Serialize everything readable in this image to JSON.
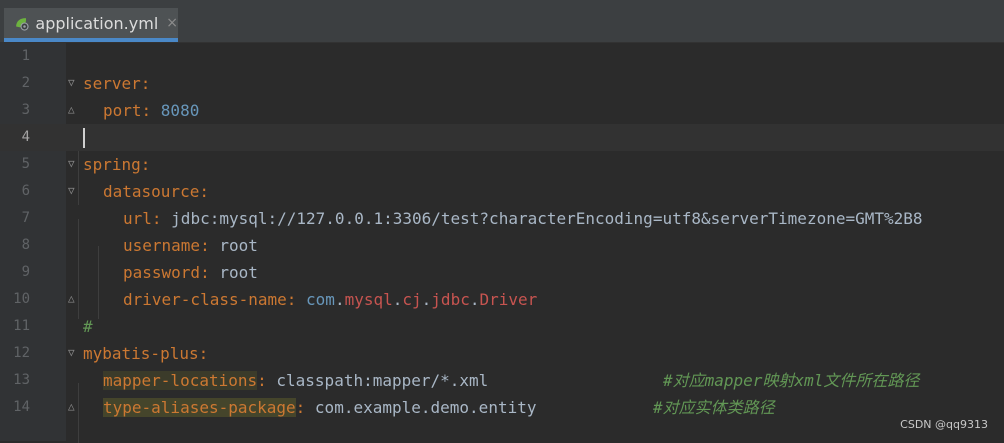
{
  "tab": {
    "title": "application.yml",
    "close": "×"
  },
  "lines": [
    {
      "num": "1"
    },
    {
      "num": "2",
      "key": "server",
      "colon": ":"
    },
    {
      "num": "3",
      "key": "port",
      "colon": ": ",
      "value": "8080"
    },
    {
      "num": "4"
    },
    {
      "num": "5",
      "key": "spring",
      "colon": ":"
    },
    {
      "num": "6",
      "key": "datasource",
      "colon": ":"
    },
    {
      "num": "7",
      "key": "url",
      "colon": ": ",
      "value": "jdbc:mysql://127.0.0.1:3306/test?characterEncoding=utf8&serverTimezone=GMT%2B8"
    },
    {
      "num": "8",
      "key": "username",
      "colon": ": ",
      "value": "root"
    },
    {
      "num": "9",
      "key": "password",
      "colon": ": ",
      "value": "root"
    },
    {
      "num": "10",
      "key": "driver-class-name",
      "colon": ": ",
      "value_parts": [
        "com",
        ".",
        "mysql",
        ".",
        "cj",
        ".",
        "jdbc",
        ".",
        "Driver"
      ]
    },
    {
      "num": "11",
      "comment": "#"
    },
    {
      "num": "12",
      "key": "mybatis-plus",
      "colon": ":"
    },
    {
      "num": "13",
      "key": "mapper-locations",
      "colon": ": ",
      "value": "classpath:mapper/*.xml",
      "comment": "#对应mapper映射xml文件所在路径"
    },
    {
      "num": "14",
      "key": "type-aliases-package",
      "colon": ": ",
      "value": "com.example.demo.entity",
      "comment": "#对应实体类路径"
    }
  ],
  "watermark": "CSDN @qq9313"
}
